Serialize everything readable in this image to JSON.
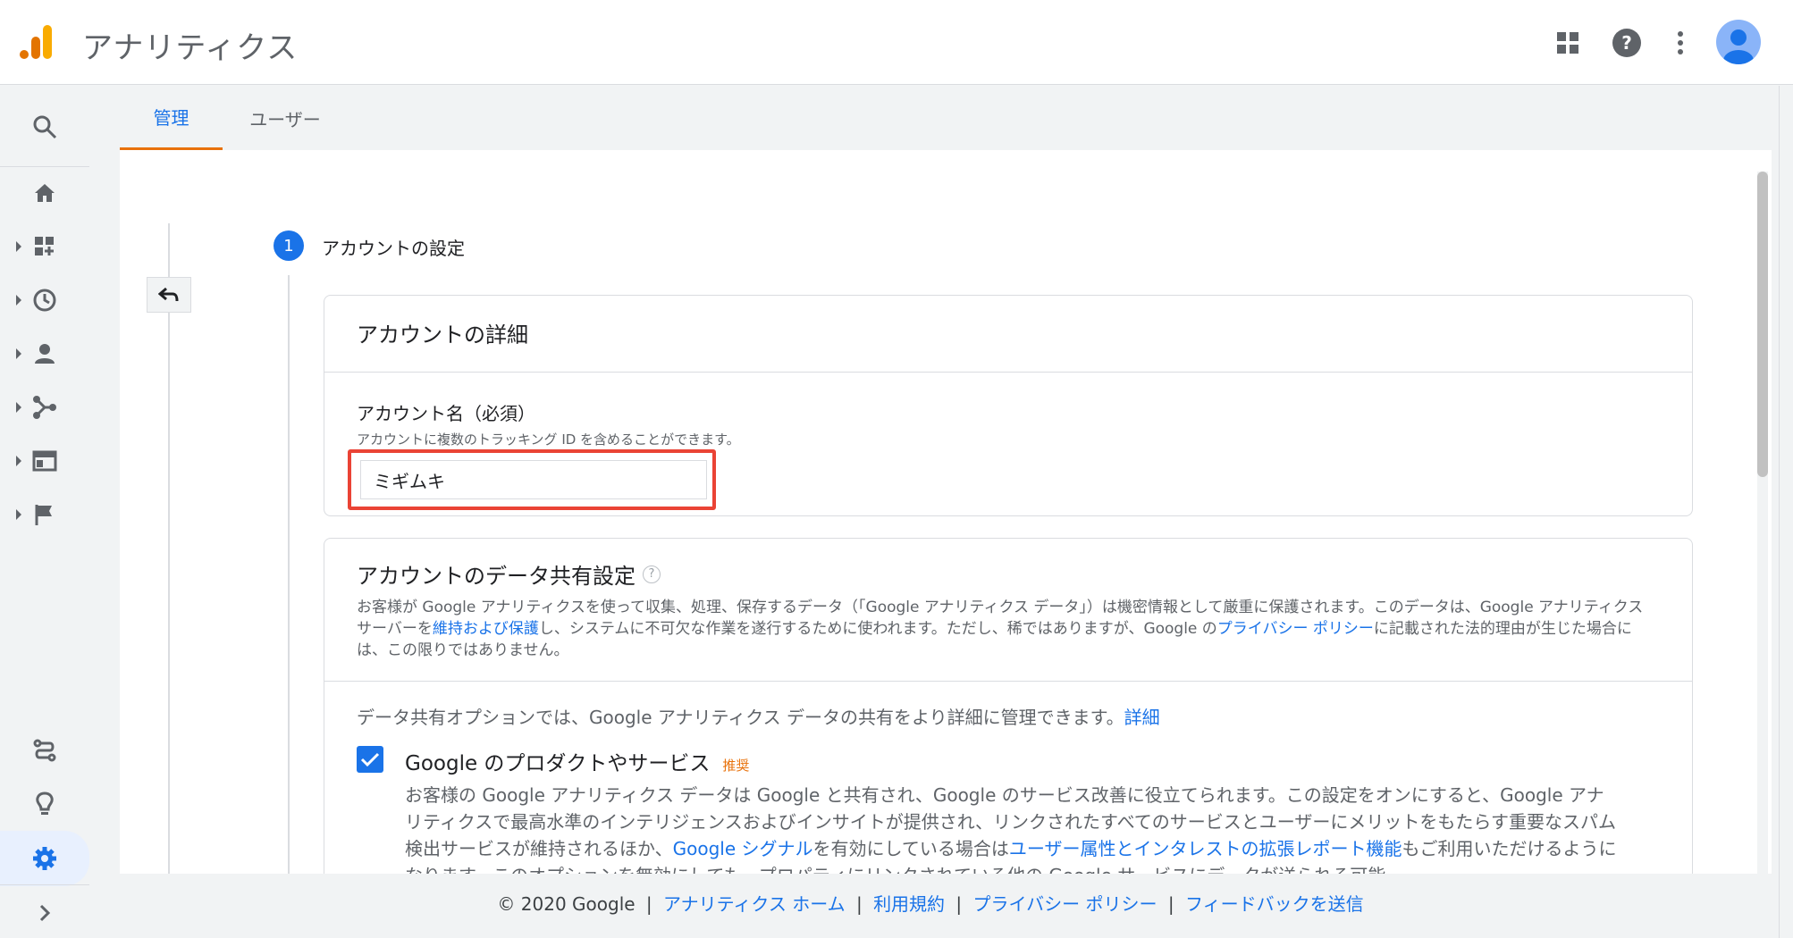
{
  "header": {
    "app_title": "アナリティクス",
    "icons": [
      "analytics-logo",
      "apps-grid-icon",
      "help-icon",
      "more-vert-icon",
      "avatar"
    ]
  },
  "rail": {
    "items": [
      "search-icon",
      "home-icon",
      "customization-icon",
      "realtime-icon",
      "audience-icon",
      "acquisition-icon",
      "behavior-icon",
      "conversions-icon",
      "attribution-icon",
      "insights-icon",
      "admin-gear-icon",
      "expand-icon"
    ]
  },
  "tabs": [
    {
      "label": "管理"
    },
    {
      "label": "ユーザー"
    }
  ],
  "step": {
    "number": "1",
    "label": "アカウントの設定"
  },
  "account_details": {
    "title": "アカウントの詳細",
    "field_label": "アカウント名（必須）",
    "field_hint": "アカウントに複数のトラッキング ID を含めることができます。",
    "field_value": "ミギムキ"
  },
  "data_sharing": {
    "title": "アカウントのデータ共有設定",
    "help": "?",
    "desc_1": "お客様が Google アナリティクスを使って収集、処理、保存するデータ（「Google アナリティクス データ」）は機密情報として厳重に保護されます。このデータは、Google アナリティクス サーバーを",
    "desc_link_1": "維持および保護",
    "desc_2": "し、システムに不可欠な作業を遂行するために使われます。ただし、稀ではありますが、Google の",
    "desc_link_2": "プライバシー ポリシー",
    "desc_3": "に記載された法的理由が生じた場合には、この限りではありません。",
    "intro": "データ共有オプションでは、Google アナリティクス データの共有をより詳細に管理できます。",
    "intro_link": "詳細",
    "option_checked": true,
    "option_title": "Google のプロダクトやサービス",
    "option_badge": "推奨",
    "option_desc_1": "お客様の Google アナリティクス データは Google と共有され、Google のサービス改善に役立てられます。この設定をオンにすると、Google アナリティクスで最高水準のインテリジェンスおよびインサイトが提供され、リンクされたすべてのサービスとユーザーにメリットをもたらす重要なスパム検出サービスが維持されるほか、",
    "option_link_1": "Google シグナル",
    "option_desc_2": "を有効にしている場合は",
    "option_link_2": "ユーザー属性とインタレストの拡張レポート機能",
    "option_desc_3": "もご利用いただけるようになります。このオプションを無効にしても、プロパティにリンクされている他の Google サービスにデータが送られる可能"
  },
  "footer": {
    "copyright": "© 2020 Google",
    "links": [
      "アナリティクス ホーム",
      "利用規約",
      "プライバシー ポリシー",
      "フィードバックを送信"
    ],
    "separator": "|"
  }
}
